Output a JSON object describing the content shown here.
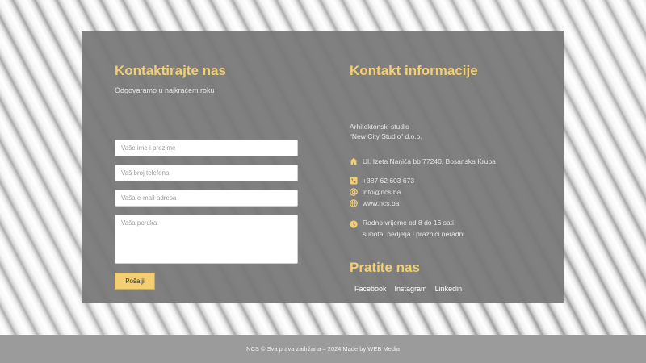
{
  "contact_form": {
    "title": "Kontaktirajte nas",
    "subtitle": "Odgovaramo u najkraćem roku",
    "name_placeholder": "Vaše ime i prezime",
    "phone_placeholder": "Vaš broj telefona",
    "email_placeholder": "Vaša e-mail adresa",
    "message_placeholder": "Vaša poruka",
    "submit_label": "Pošalji"
  },
  "contact_info": {
    "title": "Kontakt informacije",
    "company_line1": "Arhitektonski studio",
    "company_line2": "“New City Studio” d.o.o.",
    "address": "Ul. Izeta Nanića bb 77240, Bosanska Krupa",
    "phone": "+387 62 603 673",
    "email": "info@ncs.ba",
    "website": "www.ncs.ba",
    "hours_line1": "Radno vrijeme od 8 do 16 sati",
    "hours_line2": "subota, nedjelja i praznici neradni",
    "icons": [
      "home-icon",
      "phone-icon",
      "at-icon",
      "globe-icon",
      "clock-icon"
    ],
    "accent_color": "#f3cf72"
  },
  "follow": {
    "title": "Pratite nas",
    "links": [
      "Facebook",
      "Instagram",
      "Linkedin"
    ]
  },
  "footer": {
    "text": "NCS © Sva prava zadržana – 2024 Made by WEB Media"
  }
}
